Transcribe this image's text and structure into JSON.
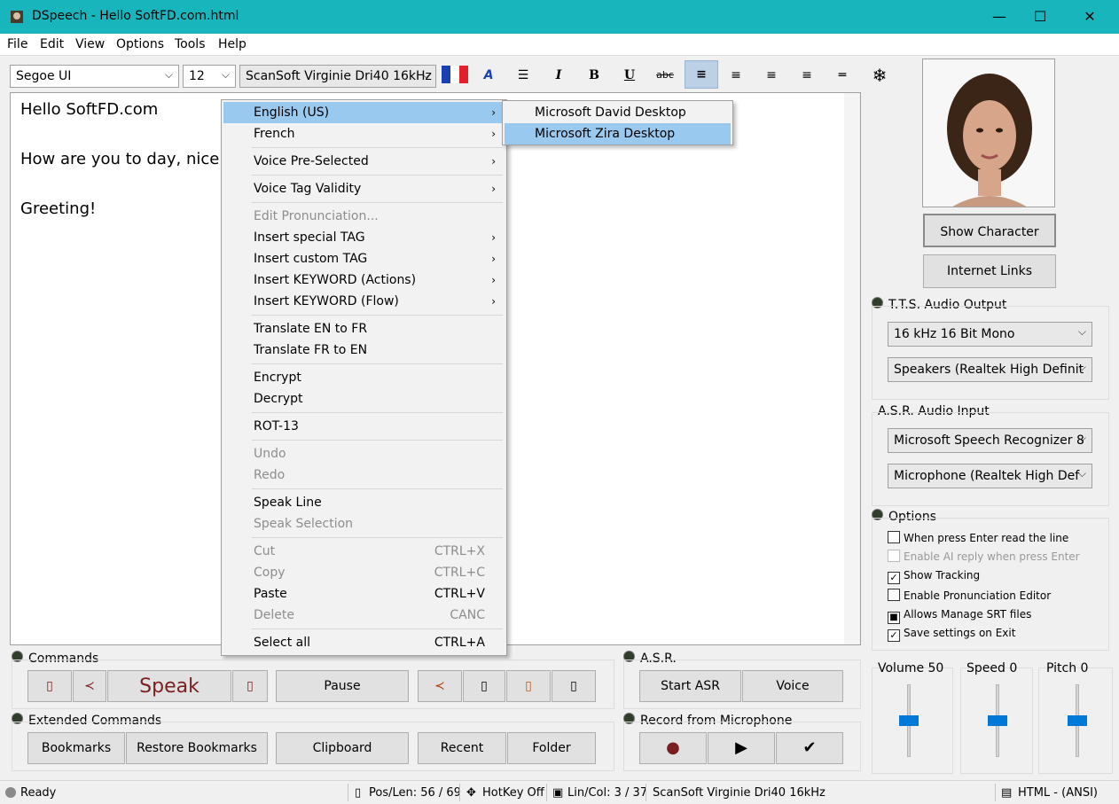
{
  "window": {
    "title": "DSpeech - Hello SoftFD.com.html",
    "minimize": "—",
    "maximize": "☐",
    "close": "✕"
  },
  "menu": [
    "File",
    "Edit",
    "View",
    "Options",
    "Tools",
    "Help"
  ],
  "toolbar": {
    "font": "Segoe UI",
    "size": "12",
    "voice": "ScanSoft Virginie Dri40 16kHz",
    "buttons": [
      "A",
      "☰",
      "I",
      "B",
      "U",
      "abc",
      "≡",
      "≡",
      "≡",
      "≡",
      "═",
      "❄"
    ]
  },
  "editor": {
    "lines": [
      "Hello SoftFD.com",
      "How are you to day, nice t",
      "Greeting!"
    ]
  },
  "context_menu": {
    "items": [
      {
        "label": "English (US)",
        "sub": "›"
      },
      {
        "label": "French",
        "sub": "›"
      },
      {
        "label": "Voice Pre-Selected",
        "sub": "›"
      },
      {
        "label": "Voice Tag Validity",
        "sub": "›"
      },
      {
        "label": "Edit Pronunciation..."
      },
      {
        "label": "Insert special TAG",
        "sub": "›"
      },
      {
        "label": "Insert custom TAG",
        "sub": "›"
      },
      {
        "label": "Insert KEYWORD (Actions)",
        "sub": "›"
      },
      {
        "label": "Insert KEYWORD (Flow)",
        "sub": "›"
      },
      {
        "label": "Translate EN to FR"
      },
      {
        "label": "Translate FR to EN"
      },
      {
        "label": "Encrypt"
      },
      {
        "label": "Decrypt"
      },
      {
        "label": "ROT-13"
      },
      {
        "label": "Undo"
      },
      {
        "label": "Redo"
      },
      {
        "label": "Speak Line"
      },
      {
        "label": "Speak Selection"
      },
      {
        "label": "Cut",
        "shortcut": "CTRL+X"
      },
      {
        "label": "Copy",
        "shortcut": "CTRL+C"
      },
      {
        "label": "Paste",
        "shortcut": "CTRL+V"
      },
      {
        "label": "Delete",
        "shortcut": "CANC"
      },
      {
        "label": "Select all",
        "shortcut": "CTRL+A"
      }
    ]
  },
  "submenu": {
    "items": [
      "Microsoft David Desktop",
      "Microsoft Zira Desktop"
    ]
  },
  "right_panel": {
    "show_character": "Show Character",
    "internet_links": "Internet Links",
    "tts_label": "T.T.S. Audio Output",
    "tts_format": "16 kHz 16 Bit Mono",
    "tts_device": "Speakers (Realtek High Definit",
    "asr_label": "A.S.R. Audio Input",
    "asr_engine": "Microsoft Speech Recognizer 8",
    "asr_device": "Microphone (Realtek High Def",
    "options_label": "Options",
    "options": [
      {
        "label": "When press Enter read the line",
        "checked": false,
        "disabled": false
      },
      {
        "label": "Enable AI reply when press Enter",
        "checked": false,
        "disabled": true
      },
      {
        "label": "Show Tracking",
        "checked": true,
        "disabled": false
      },
      {
        "label": "Enable Pronunciation Editor",
        "checked": false,
        "disabled": false
      },
      {
        "label": "Allows Manage SRT files",
        "checked": "square",
        "disabled": false
      },
      {
        "label": "Save settings on Exit",
        "checked": true,
        "disabled": false
      }
    ],
    "sliders": [
      {
        "label": "Volume 50",
        "level": 0.5
      },
      {
        "label": "Speed 0",
        "level": 0.5
      },
      {
        "label": "Pitch 0",
        "level": 0.5
      }
    ]
  },
  "commands": {
    "label": "Commands",
    "speak": "Speak",
    "pause": "Pause",
    "extended_label": "Extended Commands",
    "bookmarks": "Bookmarks",
    "restore_bookmarks": "Restore Bookmarks",
    "clipboard": "Clipboard",
    "recent": "Recent",
    "folder": "Folder"
  },
  "asr": {
    "label": "A.S.R.",
    "start": "Start ASR",
    "voice": "Voice",
    "record_label": "Record from Microphone"
  },
  "status": {
    "ready": "Ready",
    "pos": "Pos/Len: 56 / 69",
    "hotkey": "HotKey Off",
    "lincol": "Lin/Col: 3 / 37",
    "voice": "ScanSoft Virginie Dri40 16kHz",
    "format": "HTML - (ANSI)"
  },
  "colors": {
    "titlebar": "#18b5bc",
    "highlight": "#99c9ef",
    "accent": "#0078d7",
    "speak_text": "#7a1f1f"
  }
}
